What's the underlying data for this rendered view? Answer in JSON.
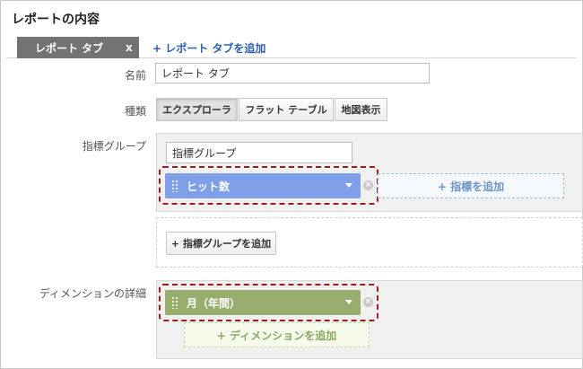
{
  "page": {
    "title": "レポートの内容"
  },
  "tabs": {
    "active_label": "レポート タブ",
    "close_glyph": "x",
    "add_label": "+ レポート タブを追加"
  },
  "name_field": {
    "label": "名前",
    "value": "レポート タブ"
  },
  "type_field": {
    "label": "種類",
    "options": [
      "エクスプローラ",
      "フラット テーブル",
      "地図表示"
    ],
    "selected": "エクスプローラ"
  },
  "metric_group": {
    "label": "指標グループ",
    "name_value": "指標グループ",
    "metric_chip": "ヒット数",
    "add_metric": "+ 指標を追加",
    "add_group_button": "+ 指標グループを追加"
  },
  "dimension": {
    "label": "ディメンションの詳細",
    "dimension_chip": "月（年間）",
    "add_dimension": "+ ディメンションを追加"
  },
  "colors": {
    "metric_chip": "#7f9fe8",
    "dimension_chip": "#96ad6d",
    "highlight": "#a11b1b",
    "tab_active": "#737373"
  },
  "icons": {
    "tab_close": "close-icon",
    "chip_grip": "drag-handle-icon",
    "chip_caret": "chevron-down-icon",
    "chip_remove": "remove-circle-icon"
  }
}
